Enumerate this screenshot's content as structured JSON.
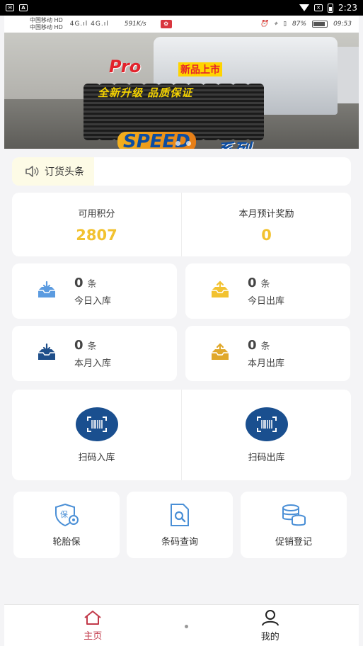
{
  "system_bar": {
    "time": "2:23"
  },
  "phone_status": {
    "carrier1": "中国移动",
    "carrier2": "中国移动",
    "net1": "HD",
    "net2": "HD",
    "signal": "4G.ıl 4G.ıl",
    "speed": "591K/s",
    "battery": "87%",
    "time": "09:53"
  },
  "banner": {
    "brand": "Pro",
    "badge": "新品上市",
    "slogan": "全新升级 品质保证",
    "logo": "SPEED",
    "series": "系列",
    "active_slide": 0,
    "slide_count": 2
  },
  "news": {
    "label": "订货头条"
  },
  "points": {
    "available_label": "可用积分",
    "available_value": "2807",
    "reward_label": "本月预计奖励",
    "reward_value": "0"
  },
  "stats": {
    "unit": "条",
    "today_in": {
      "value": "0",
      "label": "今日入库"
    },
    "today_out": {
      "value": "0",
      "label": "今日出库"
    },
    "month_in": {
      "value": "0",
      "label": "本月入库"
    },
    "month_out": {
      "value": "0",
      "label": "本月出库"
    }
  },
  "scan": {
    "in_label": "扫码入库",
    "out_label": "扫码出库"
  },
  "tools": {
    "tire_insurance": "轮胎保",
    "barcode_query": "条码查询",
    "promo_register": "促销登记"
  },
  "nav": {
    "home": "主页",
    "mine": "我的"
  },
  "colors": {
    "accent_yellow": "#f2c230",
    "nav_active": "#c23a4a",
    "scan_circle": "#1a4f8f",
    "icon_blue": "#4a8fd6"
  }
}
